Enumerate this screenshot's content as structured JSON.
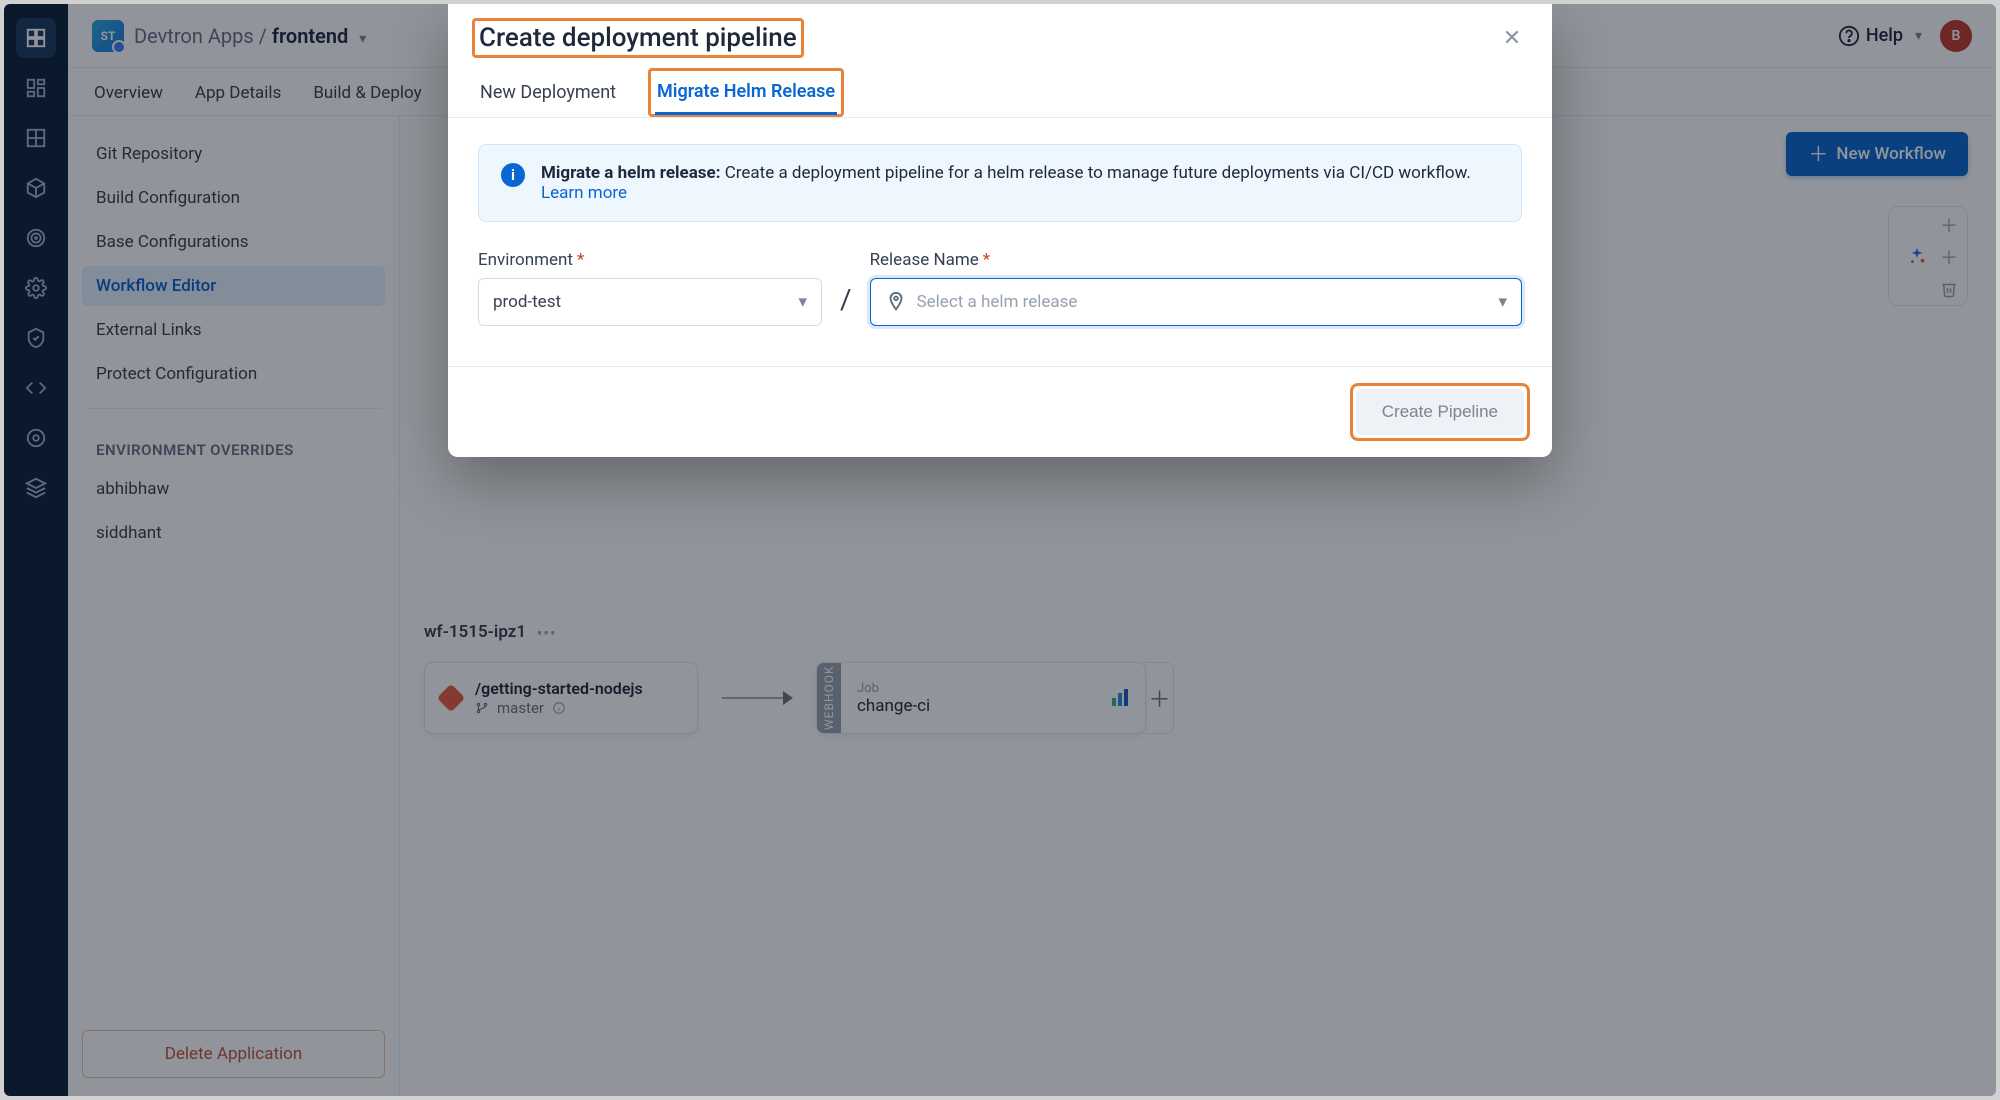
{
  "topbar": {
    "badge": "ST",
    "crumb1": "Devtron Apps",
    "crumb2": "frontend",
    "help": "Help",
    "avatar": "B"
  },
  "subtabs": {
    "overview": "Overview",
    "details": "App Details",
    "build": "Build & Deploy"
  },
  "sidebar": {
    "git": "Git Repository",
    "build": "Build Configuration",
    "base": "Base Configurations",
    "wf": "Workflow Editor",
    "ext": "External Links",
    "prot": "Protect Configuration",
    "env_label": "ENVIRONMENT OVERRIDES",
    "env1": "abhibhaw",
    "env2": "siddhant",
    "delete": "Delete Application"
  },
  "canvas": {
    "new_wf": "New Workflow",
    "wf2_name": "wf-1515-ipz1",
    "card_repo": "/getting-started-nodejs",
    "card_branch": "master",
    "job_caption": "Job",
    "job_name": "change-ci",
    "job_tab": "WEBHOOK"
  },
  "modal": {
    "title": "Create deployment pipeline",
    "tab_new": "New Deployment",
    "tab_mig": "Migrate Helm Release",
    "banner_strong": "Migrate a helm release:",
    "banner_text": " Create a deployment pipeline for a helm release to manage future deployments via CI/CD workflow.  ",
    "banner_link": "Learn more",
    "env_label": "Environment",
    "rel_label": "Release Name",
    "env_value": "prod-test",
    "rel_placeholder": "Select a helm release",
    "create": "Create Pipeline"
  }
}
